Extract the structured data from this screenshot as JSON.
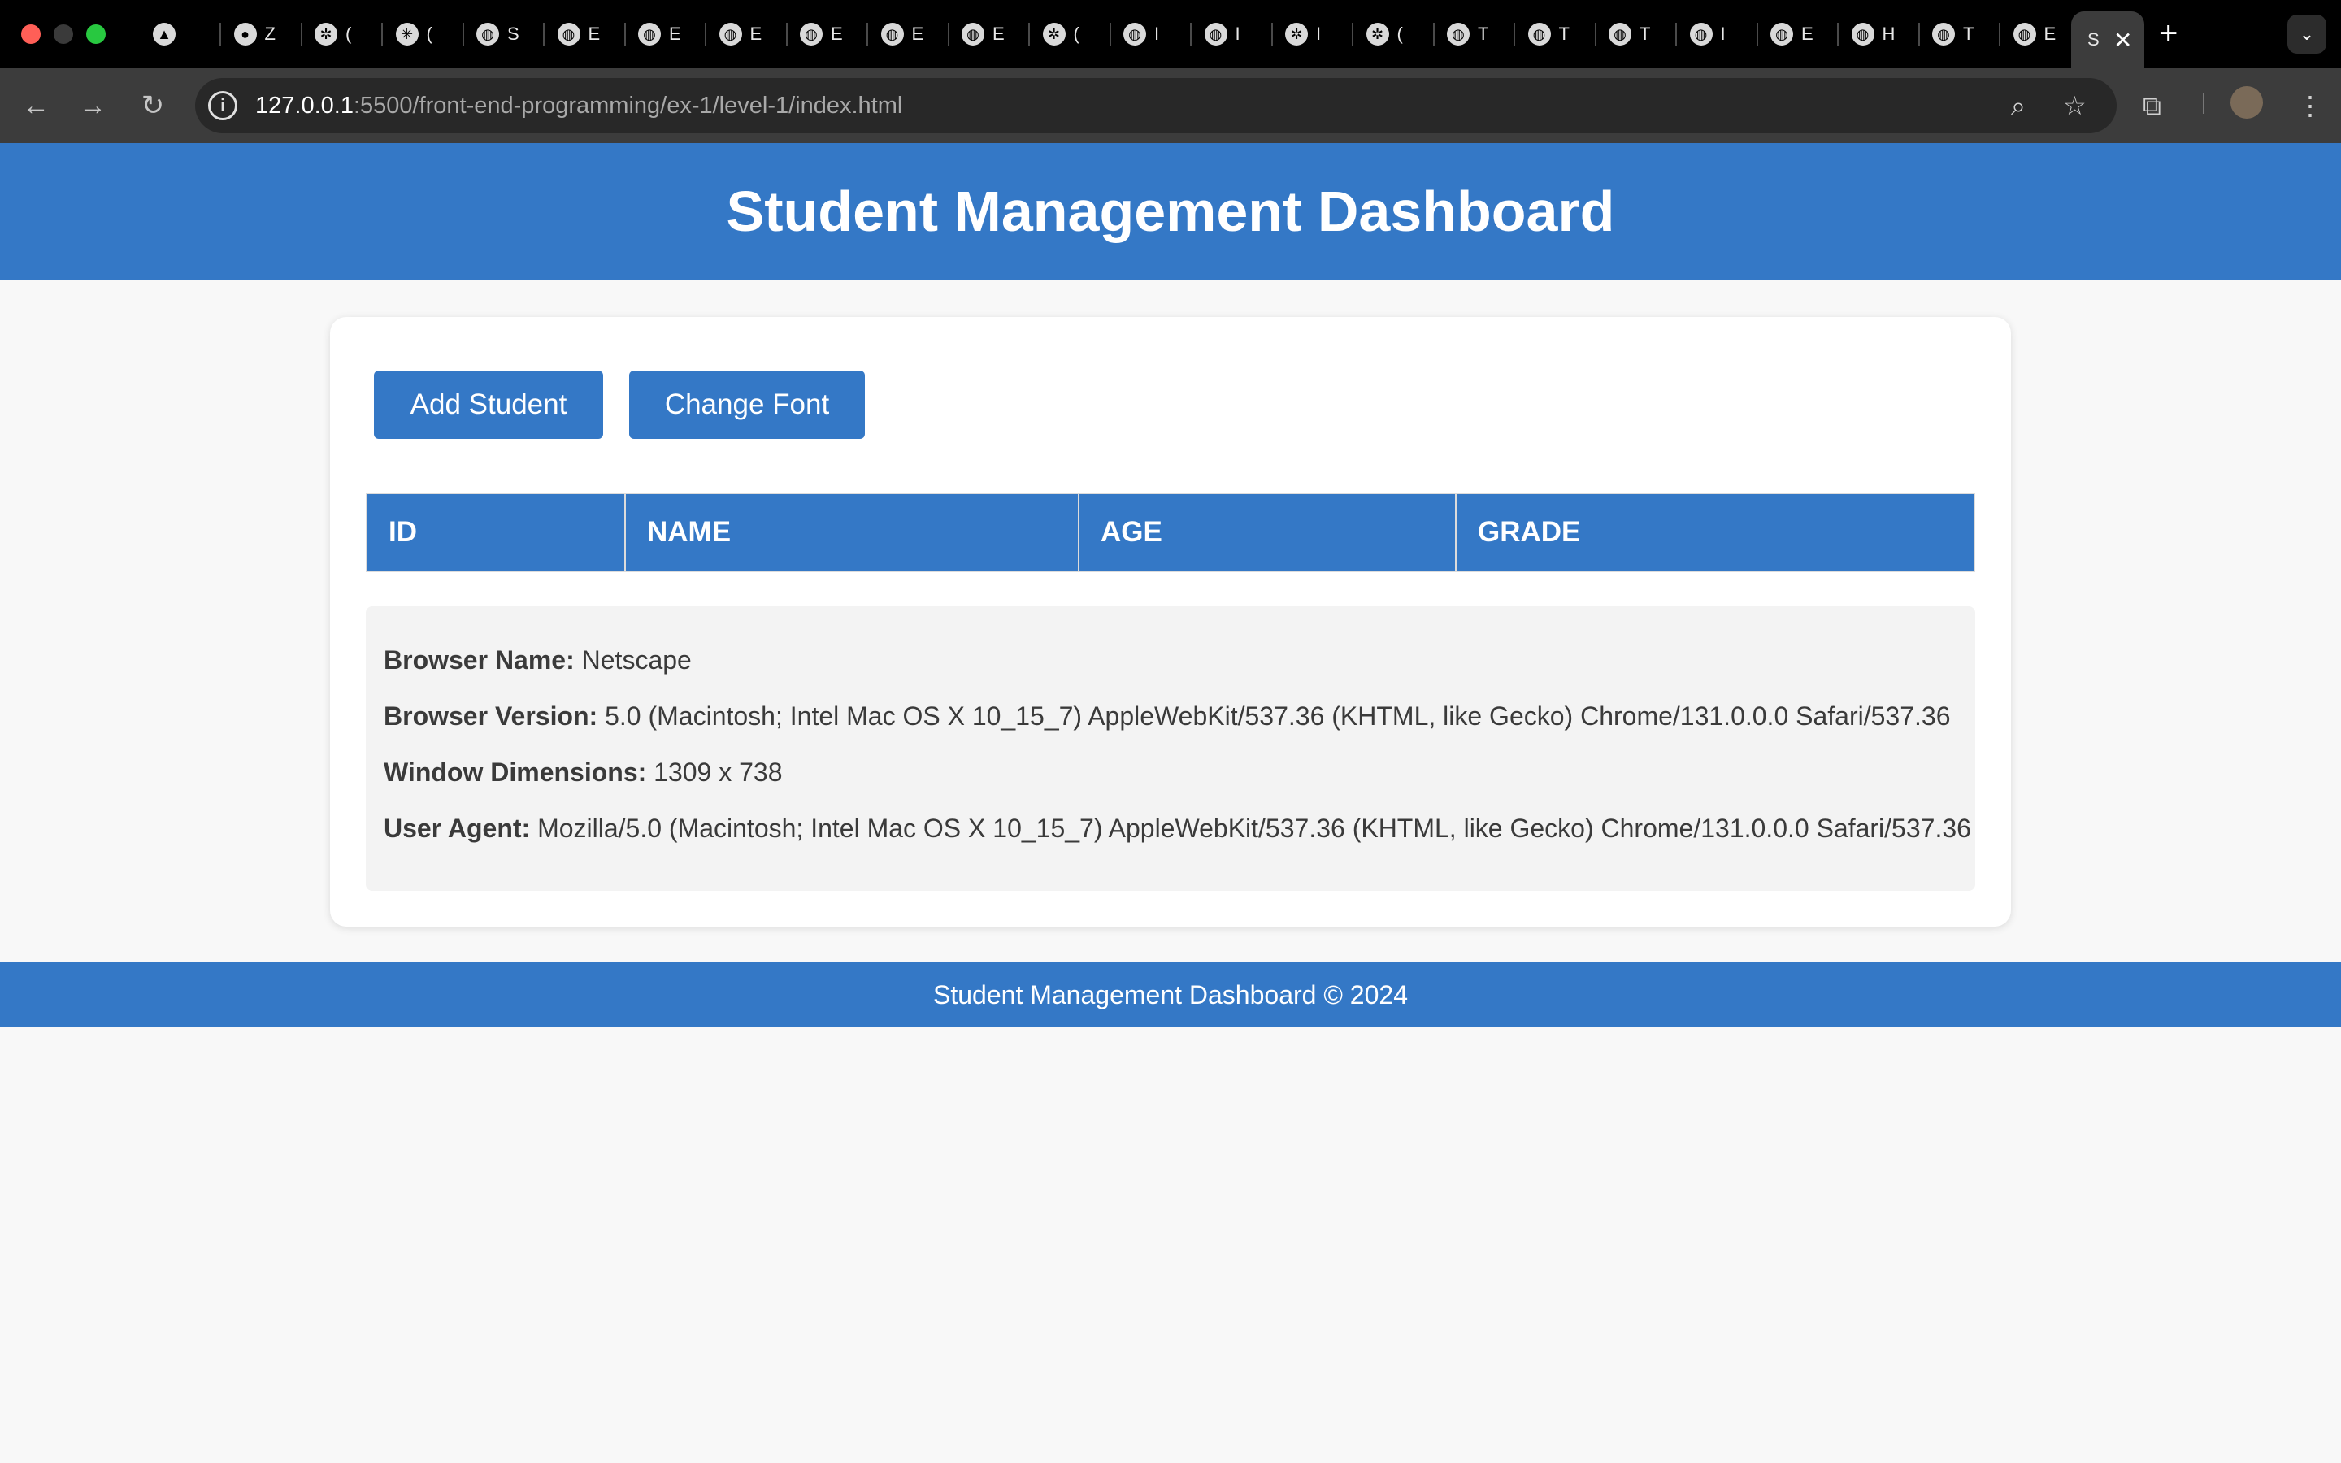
{
  "browser": {
    "tabs": [
      {
        "icon": "book-icon",
        "letter": ""
      },
      {
        "icon": "github-icon",
        "letter": "Z"
      },
      {
        "icon": "openai-icon",
        "letter": "("
      },
      {
        "icon": "claude-icon",
        "letter": "("
      },
      {
        "icon": "globe-icon",
        "letter": "S"
      },
      {
        "icon": "globe-icon",
        "letter": "E"
      },
      {
        "icon": "globe-icon",
        "letter": "E"
      },
      {
        "icon": "globe-icon",
        "letter": "E"
      },
      {
        "icon": "globe-icon",
        "letter": "E"
      },
      {
        "icon": "globe-icon",
        "letter": "E"
      },
      {
        "icon": "globe-icon",
        "letter": "E"
      },
      {
        "icon": "openai-icon",
        "letter": "("
      },
      {
        "icon": "globe-icon",
        "letter": "I"
      },
      {
        "icon": "globe-icon",
        "letter": "I"
      },
      {
        "icon": "openai-icon",
        "letter": "I"
      },
      {
        "icon": "openai-icon",
        "letter": "("
      },
      {
        "icon": "globe-icon",
        "letter": "T"
      },
      {
        "icon": "globe-icon",
        "letter": "T"
      },
      {
        "icon": "globe-icon",
        "letter": "T"
      },
      {
        "icon": "globe-icon",
        "letter": "I"
      },
      {
        "icon": "globe-icon",
        "letter": "E"
      },
      {
        "icon": "globe-icon",
        "letter": "H"
      },
      {
        "icon": "globe-icon",
        "letter": "T"
      },
      {
        "icon": "globe-icon",
        "letter": "E"
      }
    ],
    "active_tab_letter": "S",
    "url_host": "127.0.0.1",
    "url_path": ":5500/front-end-programming/ex-1/level-1/index.html"
  },
  "header": {
    "title": "Student Management Dashboard"
  },
  "actions": {
    "add_label": "Add Student",
    "font_label": "Change Font"
  },
  "table": {
    "columns": [
      "ID",
      "NAME",
      "AGE",
      "GRADE"
    ]
  },
  "info": {
    "browser_name_label": "Browser Name:",
    "browser_name": "Netscape",
    "browser_version_label": "Browser Version:",
    "browser_version": "5.0 (Macintosh; Intel Mac OS X 10_15_7) AppleWebKit/537.36 (KHTML, like Gecko) Chrome/131.0.0.0 Safari/537.36",
    "window_dimensions_label": "Window Dimensions:",
    "window_dimensions": "1309 x 738",
    "user_agent_label": "User Agent:",
    "user_agent": "Mozilla/5.0 (Macintosh; Intel Mac OS X 10_15_7) AppleWebKit/537.36 (KHTML, like Gecko) Chrome/131.0.0.0 Safari/537.36"
  },
  "footer": {
    "text": "Student Management Dashboard © 2024"
  },
  "colors": {
    "primary": "#3478c6",
    "background": "#f8f8f8",
    "info_panel": "#f3f3f3"
  }
}
